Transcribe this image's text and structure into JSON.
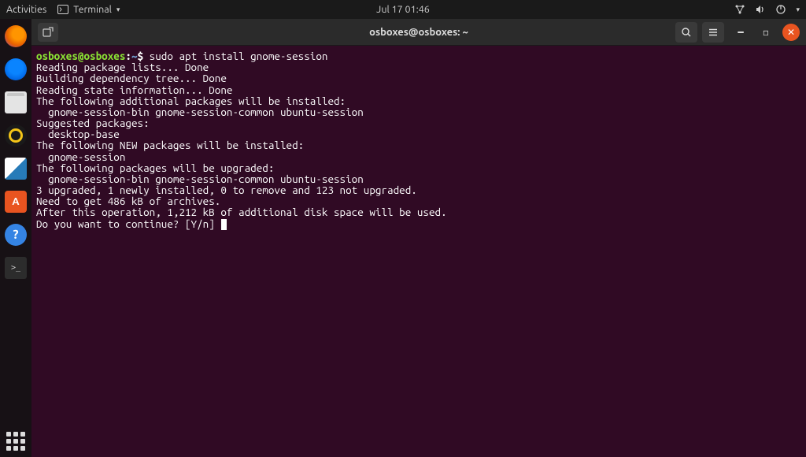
{
  "top_panel": {
    "activities": "Activities",
    "app_label": "Terminal",
    "datetime": "Jul 17  01:46"
  },
  "window": {
    "title": "osboxes@osboxes: ~"
  },
  "prompt": {
    "userhost": "osboxes@osboxes",
    "sep": ":",
    "path": "~",
    "sigil": "$",
    "command": "sudo apt install gnome-session"
  },
  "output_lines": [
    "Reading package lists... Done",
    "Building dependency tree... Done",
    "Reading state information... Done",
    "The following additional packages will be installed:",
    "  gnome-session-bin gnome-session-common ubuntu-session",
    "Suggested packages:",
    "  desktop-base",
    "The following NEW packages will be installed:",
    "  gnome-session",
    "The following packages will be upgraded:",
    "  gnome-session-bin gnome-session-common ubuntu-session",
    "3 upgraded, 1 newly installed, 0 to remove and 123 not upgraded.",
    "Need to get 486 kB of archives.",
    "After this operation, 1,212 kB of additional disk space will be used.",
    "Do you want to continue? [Y/n] "
  ]
}
